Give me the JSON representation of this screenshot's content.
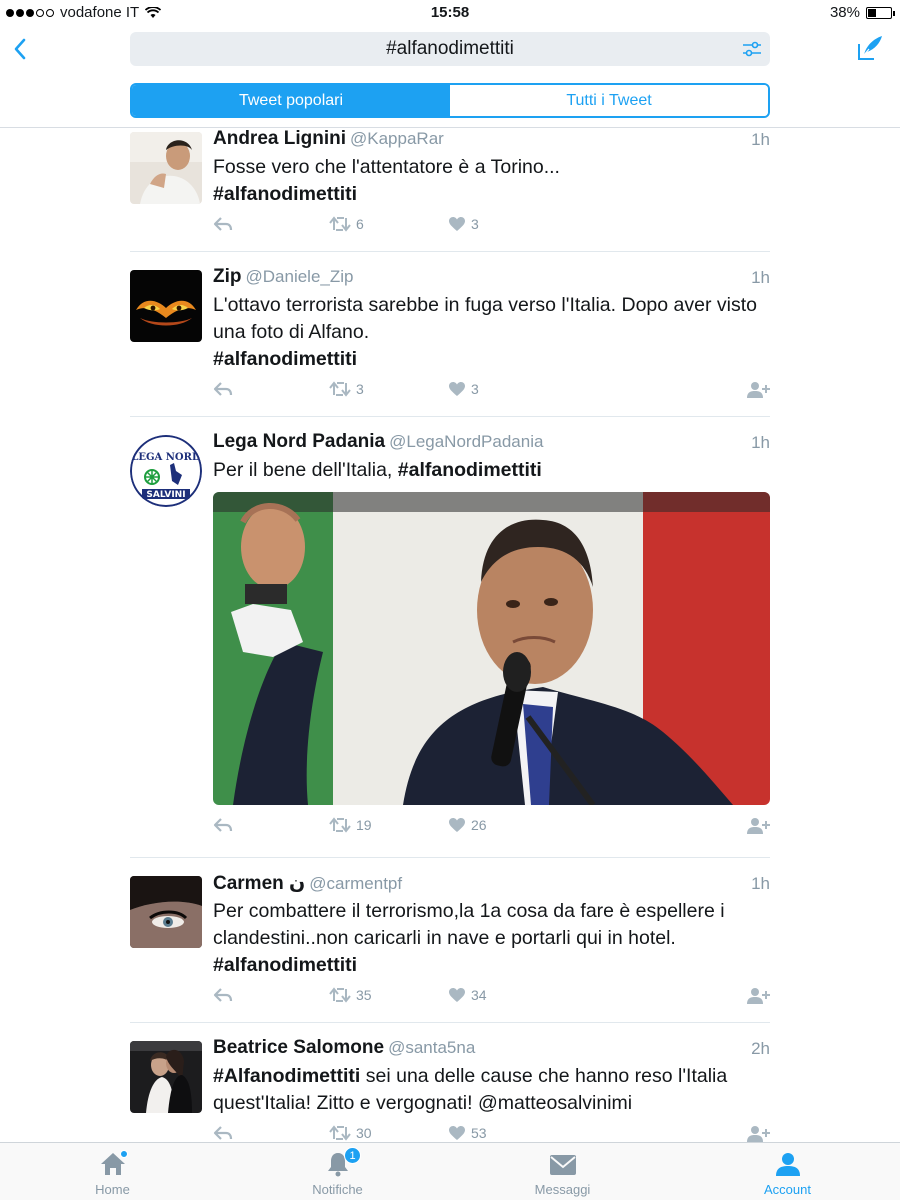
{
  "status_bar": {
    "carrier": "vodafone IT",
    "time": "15:58",
    "battery": "38%",
    "battery_level": 0.38
  },
  "header": {
    "search_query": "#alfanodimettiti",
    "tabs": [
      {
        "label": "Tweet popolari",
        "active": true
      },
      {
        "label": "Tutti i Tweet",
        "active": false
      }
    ]
  },
  "tweets": [
    {
      "name": "Andrea Lignini",
      "handle": "@KappaRar",
      "time": "1h",
      "text": "Fosse vero che l'attentatore è a Torino...",
      "hashtag": "#alfanodimettiti",
      "retweets": "6",
      "likes": "3"
    },
    {
      "name": "Zip",
      "handle": "@Daniele_Zip",
      "time": "1h",
      "text": "L'ottavo terrorista sarebbe in fuga verso l'Italia. Dopo aver visto una foto di Alfano.",
      "hashtag": "#alfanodimettiti",
      "retweets": "3",
      "likes": "3"
    },
    {
      "name": "Lega Nord Padania",
      "handle": "@LegaNordPadania",
      "time": "1h",
      "text": "Per il bene dell'Italia,",
      "hashtag": "#alfanodimettiti",
      "retweets": "19",
      "likes": "26",
      "avatar_text_top": "LEGA NORD",
      "avatar_text_bottom": "SALVINI"
    },
    {
      "name": "Carmen ن",
      "handle": "@carmentpf",
      "time": "1h",
      "text": "Per combattere il terrorismo,la 1a cosa da fare è espellere i clandestini..non caricarli in nave e portarli qui in hotel.",
      "hashtag": "#alfanodimettiti",
      "retweets": "35",
      "likes": "34"
    },
    {
      "name": "Beatrice Salomone",
      "handle": "@santa5na",
      "time": "2h",
      "hashtag": "#Alfanodimettiti",
      "text": "sei una delle cause che hanno reso l'Italia quest'Italia! Zitto e vergognati! @matteosalvinimi",
      "retweets": "30",
      "likes": "53"
    }
  ],
  "tabbar": {
    "items": [
      {
        "label": "Home",
        "icon": "home-icon"
      },
      {
        "label": "Notifiche",
        "icon": "bell-icon",
        "badge": "1"
      },
      {
        "label": "Messaggi",
        "icon": "envelope-icon"
      },
      {
        "label": "Account",
        "icon": "person-icon",
        "active": true
      }
    ]
  },
  "colors": {
    "accent": "#1da1f2",
    "muted": "#8899a6",
    "text": "#14171a"
  }
}
